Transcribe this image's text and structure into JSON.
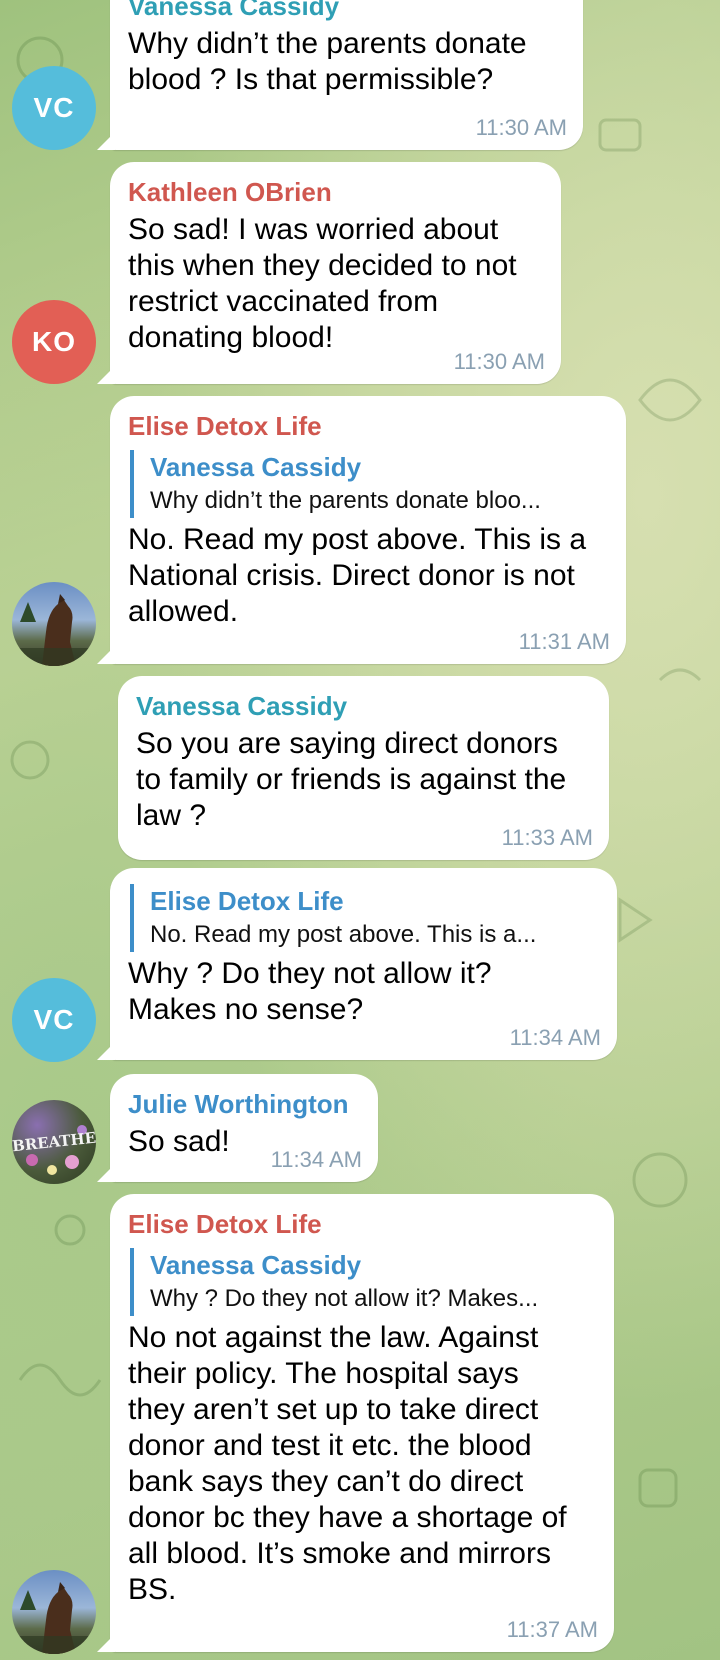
{
  "colors": {
    "name_vanessa": "#2f9fb5",
    "name_kathleen": "#d0574f",
    "name_elise": "#d0574f",
    "name_julie": "#3d8ec9",
    "reply_accent": "#3d8ec9",
    "avatar_vc": "#55bddb",
    "avatar_ko": "#e25f55"
  },
  "messages": [
    {
      "sender": "Vanessa Cassidy",
      "text": "Why didn’t the parents donate blood ? Is that permissible?",
      "time": "11:30 AM",
      "avatar": "VC"
    },
    {
      "sender": "Kathleen OBrien",
      "text": "So sad!  I was worried about this when they decided to not restrict vaccinated from donating blood!",
      "time": "11:30 AM",
      "avatar": "KO"
    },
    {
      "sender": "Elise Detox Life",
      "reply_name": "Vanessa Cassidy",
      "reply_text": "Why didn’t the parents donate bloo...",
      "text": "No. Read my post above. This is a National crisis. Direct donor is not allowed.",
      "time": "11:31 AM",
      "avatar_icon": "horse-photo-icon"
    },
    {
      "sender": "Vanessa Cassidy",
      "text": "So you are saying direct donors to family or friends is against the law ?",
      "time": "11:33 AM"
    },
    {
      "reply_name": "Elise Detox Life",
      "reply_text": "No. Read my post above. This is a...",
      "text": "Why ? Do they not allow it? Makes no sense?",
      "time": "11:34 AM",
      "avatar": "VC"
    },
    {
      "sender": "Julie Worthington",
      "text": "So sad!",
      "time": "11:34 AM",
      "avatar_text": "BREATHE"
    },
    {
      "sender": "Elise Detox Life",
      "reply_name": "Vanessa Cassidy",
      "reply_text": "Why ? Do they not allow it? Makes...",
      "text": "No not against the law. Against their policy. The hospital says they aren’t set up to take direct donor and test it etc. the blood bank says they can’t do direct donor bc they have a shortage of all blood. It’s smoke and mirrors BS.",
      "time": "11:37 AM",
      "avatar_icon": "horse-photo-icon"
    }
  ]
}
